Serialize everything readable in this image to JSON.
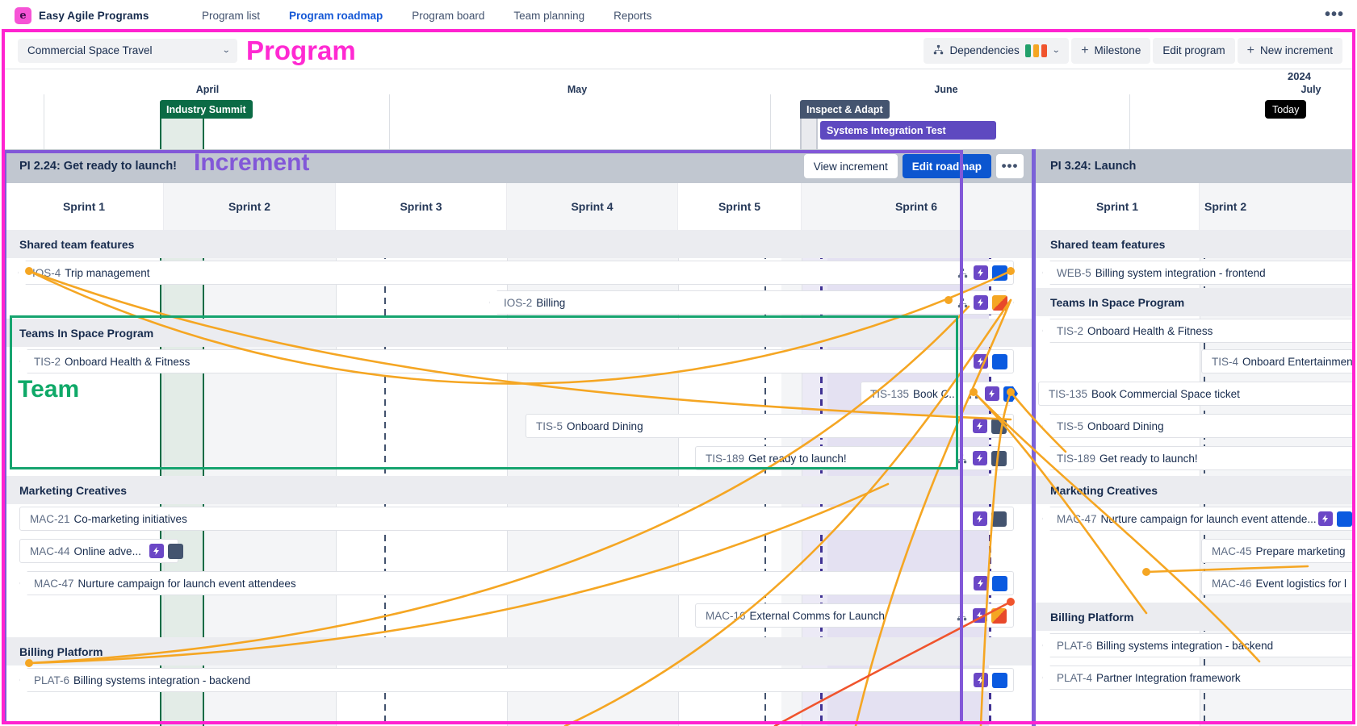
{
  "app": {
    "brand": "Easy Agile Programs",
    "logo_glyph": "e",
    "nav": [
      {
        "label": "Program list",
        "active": false
      },
      {
        "label": "Program roadmap",
        "active": true
      },
      {
        "label": "Program board",
        "active": false
      },
      {
        "label": "Team planning",
        "active": false
      },
      {
        "label": "Reports",
        "active": false
      }
    ],
    "more_glyph": "•••"
  },
  "toolbar": {
    "program_name": "Commercial Space Travel",
    "chevron": "⌄",
    "dependencies_label": "Dependencies",
    "dependency_colors": [
      "#22a06b",
      "#f5a623",
      "#f0542d"
    ],
    "milestone_label": "Milestone",
    "edit_program_label": "Edit program",
    "new_increment_label": "New increment",
    "plus": "+"
  },
  "annotations": [
    {
      "name": "program",
      "text": "Program",
      "color": "#ff29d2"
    },
    {
      "name": "increment",
      "text": "Increment",
      "color": "#8258d8"
    },
    {
      "name": "team",
      "text": "Team",
      "color": "#0fa968"
    }
  ],
  "timeline": {
    "year": "2024",
    "months": [
      "April",
      "May",
      "June",
      "July"
    ],
    "today_label": "Today",
    "milestones": [
      {
        "label": "Industry Summit",
        "color": "#0b6b45"
      },
      {
        "label": "Inspect & Adapt",
        "color": "#44546f"
      },
      {
        "label": "Systems Integration Test",
        "color": "#5e49c0"
      }
    ]
  },
  "increments": [
    {
      "title": "PI 2.24: Get ready to launch!",
      "actions": {
        "view_increment": "View increment",
        "edit_roadmap": "Edit roadmap",
        "more": "•••"
      },
      "sprints": [
        "Sprint 1",
        "Sprint 2",
        "Sprint 3",
        "Sprint 4",
        "Sprint 5",
        "Sprint 6"
      ],
      "teams": [
        {
          "name": "Shared team features",
          "issues": [
            {
              "key": "IOS-4",
              "summary": "Trip management",
              "icons": [
                "dependency",
                "story",
                "avatar-blue"
              ]
            },
            {
              "key": "IOS-2",
              "summary": "Billing",
              "icons": [
                "dependency",
                "story",
                "avatar-orange"
              ]
            }
          ]
        },
        {
          "name": "Teams In Space Program",
          "issues": [
            {
              "key": "TIS-2",
              "summary": "Onboard Health & Fitness",
              "icons": [
                "story",
                "avatar-blue"
              ]
            },
            {
              "key": "TIS-135",
              "summary": "Book C...",
              "icons": [
                "dependency",
                "story",
                "avatar-blue"
              ]
            },
            {
              "key": "TIS-5",
              "summary": "Onboard Dining",
              "icons": [
                "story",
                "avatar-dark"
              ]
            },
            {
              "key": "TIS-189",
              "summary": "Get ready to launch!",
              "icons": [
                "dependency",
                "story",
                "avatar-dark"
              ]
            }
          ]
        },
        {
          "name": "Marketing Creatives",
          "issues": [
            {
              "key": "MAC-21",
              "summary": "Co-marketing initiatives",
              "icons": [
                "story",
                "avatar-dark"
              ]
            },
            {
              "key": "MAC-44",
              "summary": "Online adve...",
              "icons": [
                "story",
                "avatar-dark"
              ]
            },
            {
              "key": "MAC-47",
              "summary": "Nurture campaign for launch event attendees",
              "icons": [
                "story",
                "avatar-blue"
              ]
            },
            {
              "key": "MAC-16",
              "summary": "External Comms for Launch",
              "icons": [
                "dependency",
                "story",
                "avatar-orange"
              ]
            }
          ]
        },
        {
          "name": "Billing Platform",
          "issues": [
            {
              "key": "PLAT-6",
              "summary": "Billing systems integration - backend",
              "icons": [
                "story",
                "avatar-blue"
              ]
            }
          ]
        }
      ]
    },
    {
      "title": "PI 3.24: Launch",
      "sprints": [
        "Sprint 1",
        "Sprint 2"
      ],
      "teams": [
        {
          "name": "Shared team features",
          "issues": [
            {
              "key": "WEB-5",
              "summary": "Billing system integration - frontend",
              "icons": []
            }
          ]
        },
        {
          "name": "Teams In Space Program",
          "issues": [
            {
              "key": "TIS-2",
              "summary": "Onboard Health & Fitness",
              "icons": []
            },
            {
              "key": "TIS-4",
              "summary": "Onboard Entertainmen",
              "icons": []
            },
            {
              "key": "TIS-135",
              "summary": "Book Commercial Space ticket",
              "icons": []
            },
            {
              "key": "TIS-5",
              "summary": "Onboard Dining",
              "icons": []
            },
            {
              "key": "TIS-189",
              "summary": "Get ready to launch!",
              "icons": []
            }
          ]
        },
        {
          "name": "Marketing Creatives",
          "issues": [
            {
              "key": "MAC-47",
              "summary": "Nurture campaign for launch event attende...",
              "icons": [
                "story",
                "avatar-blue"
              ]
            },
            {
              "key": "MAC-45",
              "summary": "Prepare marketing",
              "icons": []
            },
            {
              "key": "MAC-46",
              "summary": "Event logistics for l",
              "icons": []
            }
          ]
        },
        {
          "name": "Billing Platform",
          "issues": [
            {
              "key": "PLAT-6",
              "summary": "Billing systems integration - backend",
              "icons": []
            },
            {
              "key": "PLAT-4",
              "summary": "Partner Integration framework",
              "icons": []
            }
          ]
        }
      ]
    }
  ],
  "colors": {
    "accent_blue": "#0c56d0",
    "dependency_line": "#f5a623",
    "dependency_line_red": "#f0542d",
    "increment_header": "#c1c7d0",
    "team_header": "#ebecf0"
  }
}
